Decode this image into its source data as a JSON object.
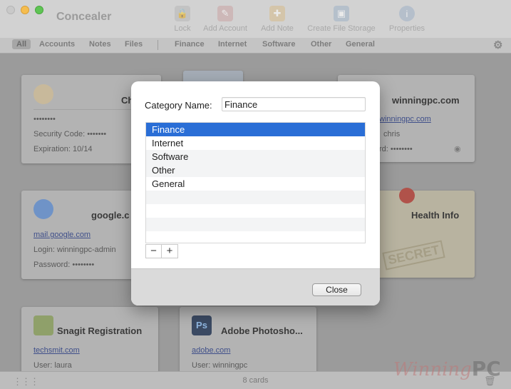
{
  "window": {
    "title": "Concealer"
  },
  "toolbar": {
    "lock": "Lock",
    "add_account": "Add Account",
    "add_note": "Add Note",
    "create_file_storage": "Create File Storage",
    "properties": "Properties"
  },
  "categories": {
    "all": "All",
    "accounts": "Accounts",
    "notes": "Notes",
    "files": "Files",
    "finance": "Finance",
    "internet": "Internet",
    "software": "Software",
    "other": "Other",
    "general": "General"
  },
  "cards": {
    "card1": {
      "title_partial": "Ch",
      "masked": "••••••••",
      "security_code": "Security Code: •••••••",
      "expiration": "Expiration: 10/14"
    },
    "card2": {
      "title": "winningpc.com",
      "link": "winningpc.com",
      "login": "chris",
      "password": "rd: ••••••••"
    },
    "card3": {
      "title": "google.c",
      "link": "mail.google.com",
      "login": "Login: winningpc-admin",
      "password": "Password: ••••••••"
    },
    "card4": {
      "title": "Health Info",
      "stamp": "SECRET"
    },
    "card5": {
      "title": "Snagit Registration",
      "link": "techsmit.com",
      "user": "User: laura"
    },
    "card6": {
      "title": "Adobe Photosho...",
      "link": "adobe.com",
      "user": "User: winningpc",
      "icon_text": "Ps"
    }
  },
  "status": {
    "count": "8 cards"
  },
  "watermark": {
    "script": "Winning",
    "bold": "PC"
  },
  "dialog": {
    "category_label": "Category Name:",
    "category_value": "Finance",
    "list": [
      "Finance",
      "Internet",
      "Software",
      "Other",
      "General"
    ],
    "selected_index": 0,
    "minus": "−",
    "plus": "+",
    "close_label": "Close"
  },
  "colors": {
    "selection": "#2a6ed6",
    "link": "#3f4f8a"
  }
}
